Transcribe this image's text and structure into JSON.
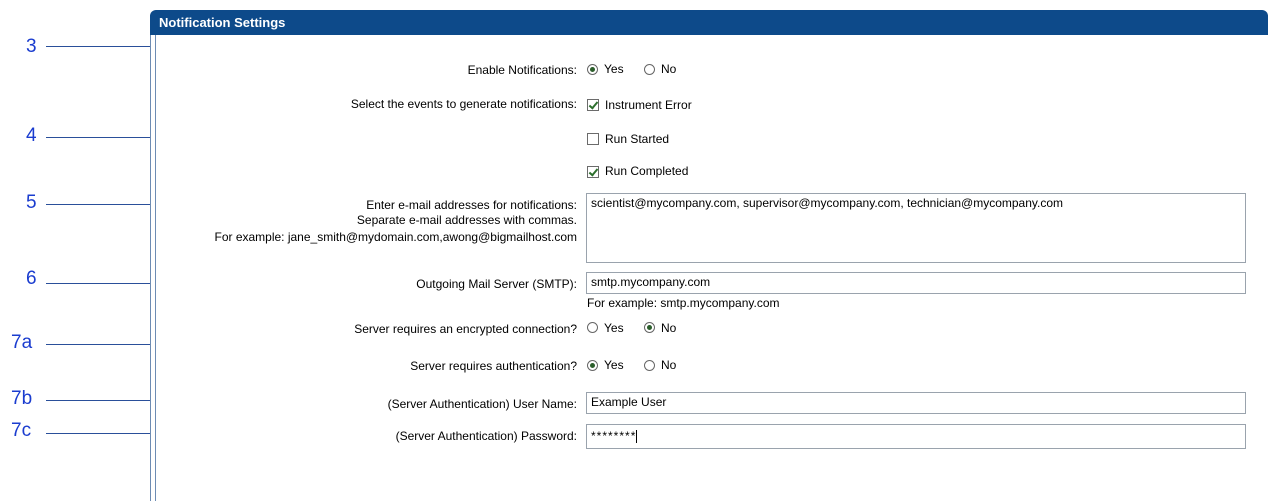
{
  "panel": {
    "title": "Notification Settings"
  },
  "callouts": [
    "3",
    "4",
    "5",
    "6",
    "7a",
    "7b",
    "7c"
  ],
  "enable": {
    "label": "Enable Notifications:",
    "yes": "Yes",
    "no": "No",
    "selected": "Yes"
  },
  "events": {
    "label": "Select the events to generate notifications:",
    "items": [
      {
        "label": "Instrument Error",
        "checked": true
      },
      {
        "label": "Run Started",
        "checked": false
      },
      {
        "label": "Run Completed",
        "checked": true
      }
    ]
  },
  "emails": {
    "label_line1": "Enter e-mail addresses for notifications:",
    "label_line2": "Separate e-mail addresses with commas.",
    "label_line3": "For example: jane_smith@mydomain.com,awong@bigmailhost.com",
    "value": "scientist@mycompany.com, supervisor@mycompany.com, technician@mycompany.com"
  },
  "smtp": {
    "label": "Outgoing Mail Server (SMTP):",
    "value": "smtp.mycompany.com",
    "hint": "For example: smtp.mycompany.com"
  },
  "encrypted": {
    "label": "Server requires an encrypted connection?",
    "yes": "Yes",
    "no": "No",
    "selected": "No"
  },
  "auth": {
    "label": "Server requires authentication?",
    "yes": "Yes",
    "no": "No",
    "selected": "Yes"
  },
  "username": {
    "label": "(Server Authentication) User Name:",
    "value": "Example User"
  },
  "password": {
    "label": "(Server Authentication) Password:",
    "value": "********"
  }
}
